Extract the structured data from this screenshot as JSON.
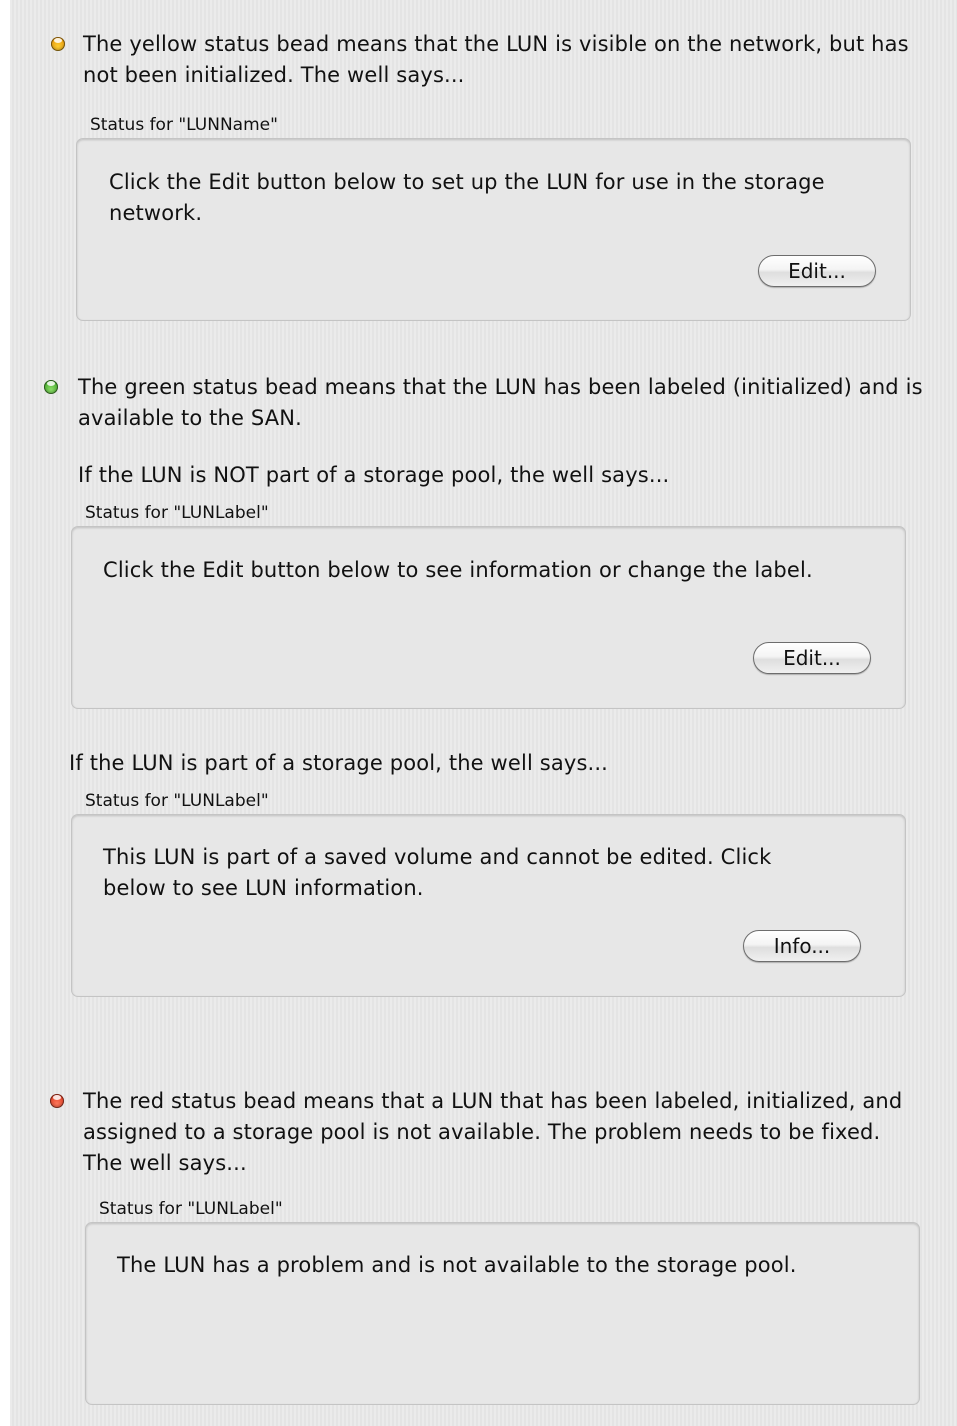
{
  "colors": {
    "yellow_bead": "#f2a100",
    "green_bead": "#3aa81e",
    "red_bead": "#e03a1e",
    "well_background": "#e7e7e7",
    "panel_background": "#e9e9e9"
  },
  "sections": {
    "yellow": {
      "bead_icon": "yellow-status-bead",
      "description": "The yellow status bead means that the LUN is visible on the network, but has not been initialized. The well says...",
      "well_label": "Status for \"LUNName\"",
      "well_text": "Click the Edit button below to set up the LUN for use in the storage network.",
      "button_label": "Edit..."
    },
    "green": {
      "bead_icon": "green-status-bead",
      "description": "The green status bead means that the LUN has been labeled (initialized) and is available to the SAN.",
      "not_in_pool_intro": "If the LUN is NOT part of a storage pool, the well says...",
      "not_in_pool_well_label": "Status for \"LUNLabel\"",
      "not_in_pool_well_text": "Click the Edit button below to see information or change the label.",
      "not_in_pool_button_label": "Edit...",
      "in_pool_intro": "If the LUN is part of a storage pool, the well says...",
      "in_pool_well_label": "Status for \"LUNLabel\"",
      "in_pool_well_text": "This LUN is part of a saved volume and cannot be edited. Click below to see LUN information.",
      "in_pool_button_label": "Info..."
    },
    "red": {
      "bead_icon": "red-status-bead",
      "description": "The red status bead means that a LUN that has been labeled, initialized, and assigned to a storage pool is not available. The problem needs to be fixed. The well says...",
      "well_label": "Status for \"LUNLabel\"",
      "well_text": "The LUN has a problem and is not available to the storage pool."
    }
  }
}
